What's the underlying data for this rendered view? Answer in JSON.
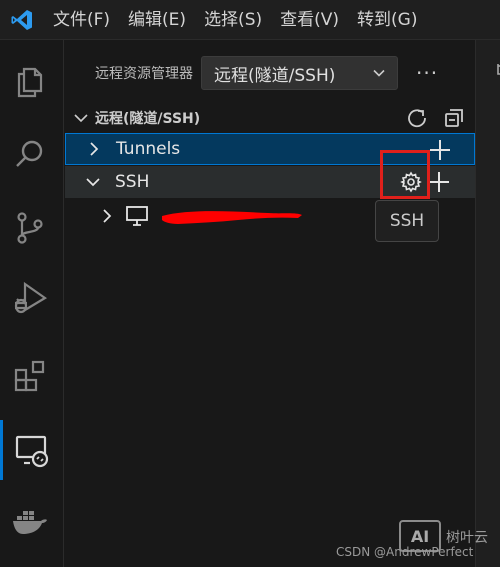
{
  "menu": [
    "文件(F)",
    "编辑(E)",
    "选择(S)",
    "查看(V)",
    "转到(G)"
  ],
  "activity_icons": [
    "explorer-icon",
    "search-icon",
    "source-control-icon",
    "run-debug-icon",
    "extensions-icon",
    "remote-explorer-icon",
    "docker-icon"
  ],
  "sidebar": {
    "title": "远程资源管理器",
    "select_value": "远程(隧道/SSH)",
    "more": "···",
    "section_title": "远程(隧道/SSH)",
    "tunnels_label": "Tunnels",
    "ssh_label": "SSH"
  },
  "tooltip": "SSH",
  "watermark": {
    "text": "CSDN @AndrewPerfect",
    "logo_text": "AI",
    "brand": "树叶云"
  },
  "colors": {
    "accent": "#0078d4",
    "highlight": "#e0201b",
    "redaction": "#ff0000"
  }
}
